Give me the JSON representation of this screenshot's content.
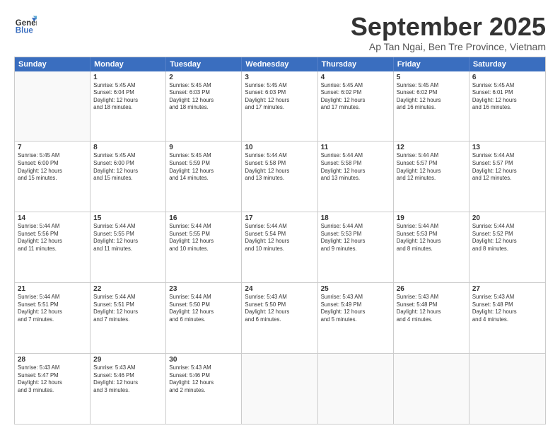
{
  "header": {
    "logo_line1": "General",
    "logo_line2": "Blue",
    "month": "September 2025",
    "location": "Ap Tan Ngai, Ben Tre Province, Vietnam"
  },
  "weekdays": [
    "Sunday",
    "Monday",
    "Tuesday",
    "Wednesday",
    "Thursday",
    "Friday",
    "Saturday"
  ],
  "rows": [
    [
      {
        "day": "",
        "lines": []
      },
      {
        "day": "1",
        "lines": [
          "Sunrise: 5:45 AM",
          "Sunset: 6:04 PM",
          "Daylight: 12 hours",
          "and 18 minutes."
        ]
      },
      {
        "day": "2",
        "lines": [
          "Sunrise: 5:45 AM",
          "Sunset: 6:03 PM",
          "Daylight: 12 hours",
          "and 18 minutes."
        ]
      },
      {
        "day": "3",
        "lines": [
          "Sunrise: 5:45 AM",
          "Sunset: 6:03 PM",
          "Daylight: 12 hours",
          "and 17 minutes."
        ]
      },
      {
        "day": "4",
        "lines": [
          "Sunrise: 5:45 AM",
          "Sunset: 6:02 PM",
          "Daylight: 12 hours",
          "and 17 minutes."
        ]
      },
      {
        "day": "5",
        "lines": [
          "Sunrise: 5:45 AM",
          "Sunset: 6:02 PM",
          "Daylight: 12 hours",
          "and 16 minutes."
        ]
      },
      {
        "day": "6",
        "lines": [
          "Sunrise: 5:45 AM",
          "Sunset: 6:01 PM",
          "Daylight: 12 hours",
          "and 16 minutes."
        ]
      }
    ],
    [
      {
        "day": "7",
        "lines": [
          "Sunrise: 5:45 AM",
          "Sunset: 6:00 PM",
          "Daylight: 12 hours",
          "and 15 minutes."
        ]
      },
      {
        "day": "8",
        "lines": [
          "Sunrise: 5:45 AM",
          "Sunset: 6:00 PM",
          "Daylight: 12 hours",
          "and 15 minutes."
        ]
      },
      {
        "day": "9",
        "lines": [
          "Sunrise: 5:45 AM",
          "Sunset: 5:59 PM",
          "Daylight: 12 hours",
          "and 14 minutes."
        ]
      },
      {
        "day": "10",
        "lines": [
          "Sunrise: 5:44 AM",
          "Sunset: 5:58 PM",
          "Daylight: 12 hours",
          "and 13 minutes."
        ]
      },
      {
        "day": "11",
        "lines": [
          "Sunrise: 5:44 AM",
          "Sunset: 5:58 PM",
          "Daylight: 12 hours",
          "and 13 minutes."
        ]
      },
      {
        "day": "12",
        "lines": [
          "Sunrise: 5:44 AM",
          "Sunset: 5:57 PM",
          "Daylight: 12 hours",
          "and 12 minutes."
        ]
      },
      {
        "day": "13",
        "lines": [
          "Sunrise: 5:44 AM",
          "Sunset: 5:57 PM",
          "Daylight: 12 hours",
          "and 12 minutes."
        ]
      }
    ],
    [
      {
        "day": "14",
        "lines": [
          "Sunrise: 5:44 AM",
          "Sunset: 5:56 PM",
          "Daylight: 12 hours",
          "and 11 minutes."
        ]
      },
      {
        "day": "15",
        "lines": [
          "Sunrise: 5:44 AM",
          "Sunset: 5:55 PM",
          "Daylight: 12 hours",
          "and 11 minutes."
        ]
      },
      {
        "day": "16",
        "lines": [
          "Sunrise: 5:44 AM",
          "Sunset: 5:55 PM",
          "Daylight: 12 hours",
          "and 10 minutes."
        ]
      },
      {
        "day": "17",
        "lines": [
          "Sunrise: 5:44 AM",
          "Sunset: 5:54 PM",
          "Daylight: 12 hours",
          "and 10 minutes."
        ]
      },
      {
        "day": "18",
        "lines": [
          "Sunrise: 5:44 AM",
          "Sunset: 5:53 PM",
          "Daylight: 12 hours",
          "and 9 minutes."
        ]
      },
      {
        "day": "19",
        "lines": [
          "Sunrise: 5:44 AM",
          "Sunset: 5:53 PM",
          "Daylight: 12 hours",
          "and 8 minutes."
        ]
      },
      {
        "day": "20",
        "lines": [
          "Sunrise: 5:44 AM",
          "Sunset: 5:52 PM",
          "Daylight: 12 hours",
          "and 8 minutes."
        ]
      }
    ],
    [
      {
        "day": "21",
        "lines": [
          "Sunrise: 5:44 AM",
          "Sunset: 5:51 PM",
          "Daylight: 12 hours",
          "and 7 minutes."
        ]
      },
      {
        "day": "22",
        "lines": [
          "Sunrise: 5:44 AM",
          "Sunset: 5:51 PM",
          "Daylight: 12 hours",
          "and 7 minutes."
        ]
      },
      {
        "day": "23",
        "lines": [
          "Sunrise: 5:44 AM",
          "Sunset: 5:50 PM",
          "Daylight: 12 hours",
          "and 6 minutes."
        ]
      },
      {
        "day": "24",
        "lines": [
          "Sunrise: 5:43 AM",
          "Sunset: 5:50 PM",
          "Daylight: 12 hours",
          "and 6 minutes."
        ]
      },
      {
        "day": "25",
        "lines": [
          "Sunrise: 5:43 AM",
          "Sunset: 5:49 PM",
          "Daylight: 12 hours",
          "and 5 minutes."
        ]
      },
      {
        "day": "26",
        "lines": [
          "Sunrise: 5:43 AM",
          "Sunset: 5:48 PM",
          "Daylight: 12 hours",
          "and 4 minutes."
        ]
      },
      {
        "day": "27",
        "lines": [
          "Sunrise: 5:43 AM",
          "Sunset: 5:48 PM",
          "Daylight: 12 hours",
          "and 4 minutes."
        ]
      }
    ],
    [
      {
        "day": "28",
        "lines": [
          "Sunrise: 5:43 AM",
          "Sunset: 5:47 PM",
          "Daylight: 12 hours",
          "and 3 minutes."
        ]
      },
      {
        "day": "29",
        "lines": [
          "Sunrise: 5:43 AM",
          "Sunset: 5:46 PM",
          "Daylight: 12 hours",
          "and 3 minutes."
        ]
      },
      {
        "day": "30",
        "lines": [
          "Sunrise: 5:43 AM",
          "Sunset: 5:46 PM",
          "Daylight: 12 hours",
          "and 2 minutes."
        ]
      },
      {
        "day": "",
        "lines": []
      },
      {
        "day": "",
        "lines": []
      },
      {
        "day": "",
        "lines": []
      },
      {
        "day": "",
        "lines": []
      }
    ]
  ]
}
